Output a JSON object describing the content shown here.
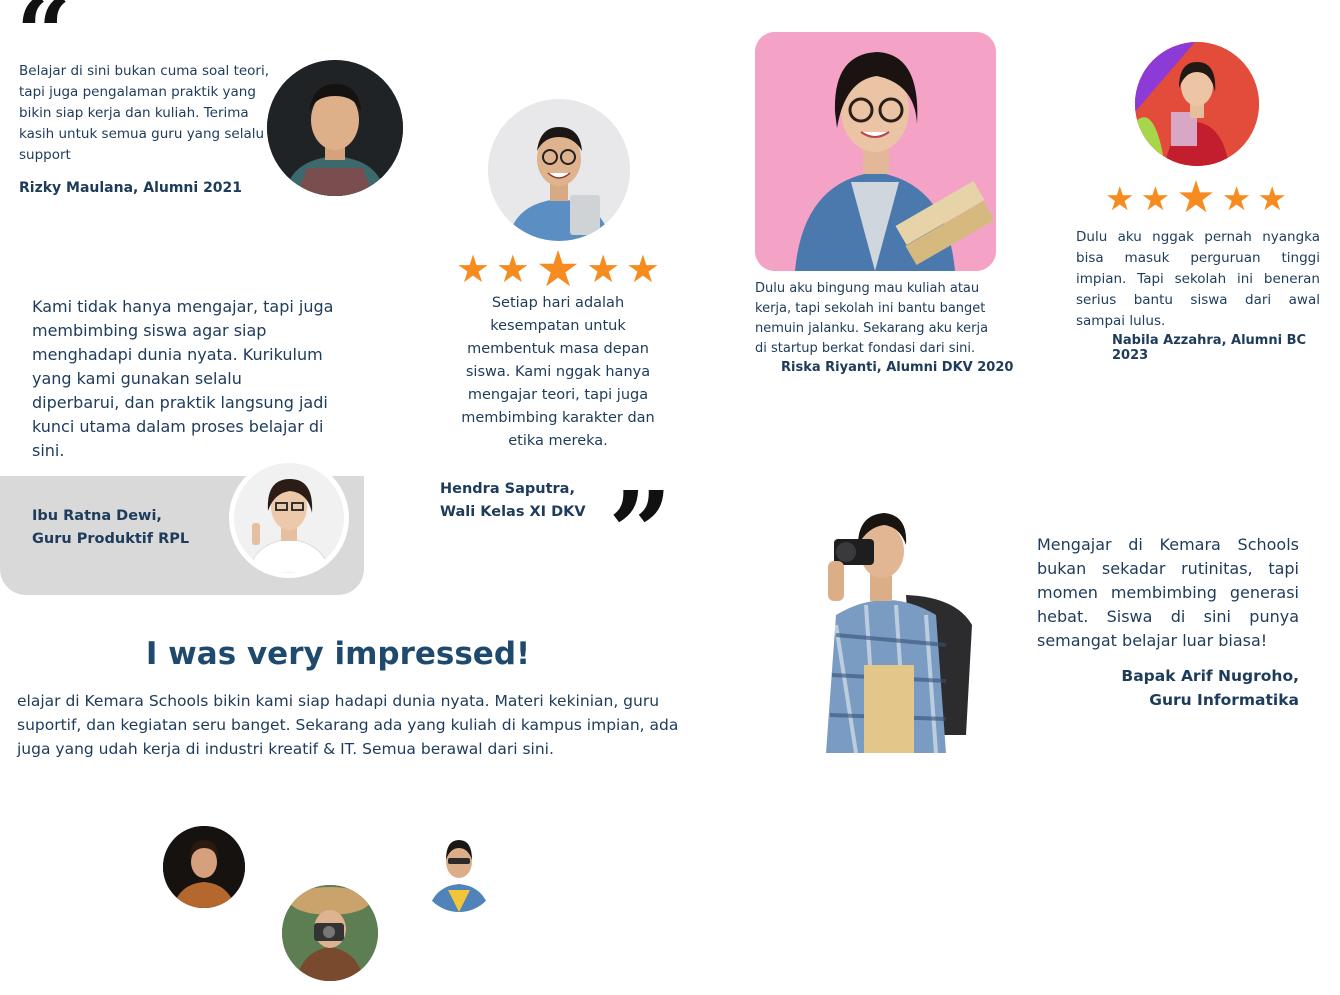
{
  "colors": {
    "accent": "#f68b1f",
    "text": "#1d3b5a",
    "card": "#d9d9d9",
    "pink": "#f4a0c6"
  },
  "open_quote": "“",
  "close_quote": "”",
  "t1": {
    "text": "Belajar di sini bukan cuma soal teori, tapi juga pengalaman praktik yang bikin siap kerja dan kuliah. Terima kasih untuk semua guru yang selalu support",
    "name": "Rizky Maulana, Alumni 2021"
  },
  "t2": {
    "text": "Setiap hari adalah kesempatan untuk membentuk masa depan siswa. Kami nggak hanya mengajar teori, tapi juga membimbing karakter dan etika mereka.",
    "name_line1": "Hendra Saputra,",
    "name_line2": "Wali Kelas XI DKV",
    "rating": 5
  },
  "t3": {
    "text": "Dulu aku bingung mau kuliah atau kerja, tapi sekolah ini bantu banget nemuin jalanku. Sekarang aku kerja di startup berkat fondasi dari sini.",
    "name": "Riska Riyanti, Alumni DKV 2020"
  },
  "t4": {
    "text": "Dulu aku nggak pernah nyangka bisa masuk perguruan tinggi impian. Tapi sekolah ini beneran serius bantu siswa dari awal sampai lulus.",
    "name": "Nabila Azzahra, Alumni BC 2023",
    "rating": 5
  },
  "t5": {
    "text": "Kami tidak hanya mengajar, tapi juga membimbing siswa agar siap menghadapi dunia nyata. Kurikulum yang kami gunakan selalu diperbarui, dan praktik langsung jadi kunci utama dalam proses belajar di sini.",
    "name_line1": "Ibu Ratna Dewi,",
    "name_line2": "Guru Produktif RPL"
  },
  "t6": {
    "text": "Mengajar di Kemara Schools bukan sekadar rutinitas, tapi momen membimbing generasi hebat. Siswa di sini punya semangat belajar luar biasa!",
    "name_line1": "Bapak Arif Nugroho,",
    "name_line2": "Guru Informatika"
  },
  "impressed": {
    "heading": "I was very impressed!",
    "text": "elajar di Kemara Schools bikin kami siap hadapi dunia nyata. Materi kekinian, guru suportif, dan kegiatan seru banget. Sekarang ada yang kuliah di kampus impian, ada juga yang udah kerja di industri kreatif & IT. Semua berawal dari sini."
  },
  "star_glyph": "★"
}
